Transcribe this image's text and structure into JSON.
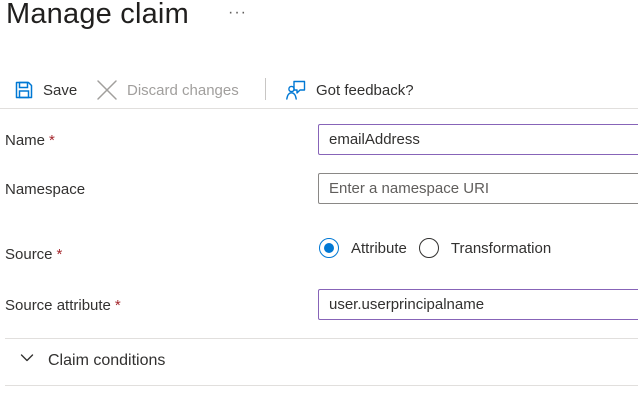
{
  "header": {
    "title": "Manage claim",
    "more_label": "···"
  },
  "toolbar": {
    "save_label": "Save",
    "discard_label": "Discard changes",
    "feedback_label": "Got feedback?"
  },
  "form": {
    "name": {
      "label": "Name",
      "required_mark": "*",
      "value": "emailAddress"
    },
    "namespace": {
      "label": "Namespace",
      "placeholder": "Enter a namespace URI",
      "value": ""
    },
    "source": {
      "label": "Source",
      "required_mark": "*",
      "options": [
        {
          "label": "Attribute",
          "checked": true
        },
        {
          "label": "Transformation",
          "checked": false
        }
      ]
    },
    "source_attribute": {
      "label": "Source attribute",
      "required_mark": "*",
      "value": "user.userprincipalname"
    }
  },
  "sections": {
    "claim_conditions": {
      "label": "Claim conditions",
      "expanded": false
    }
  },
  "colors": {
    "accent": "#0078d4",
    "required": "#a4262c",
    "focus_border": "#8764b8"
  },
  "icons": {
    "save": "save-icon",
    "discard": "close-icon",
    "feedback": "feedback-icon",
    "more": "ellipsis-icon",
    "conditions": "chevron-down-icon"
  }
}
